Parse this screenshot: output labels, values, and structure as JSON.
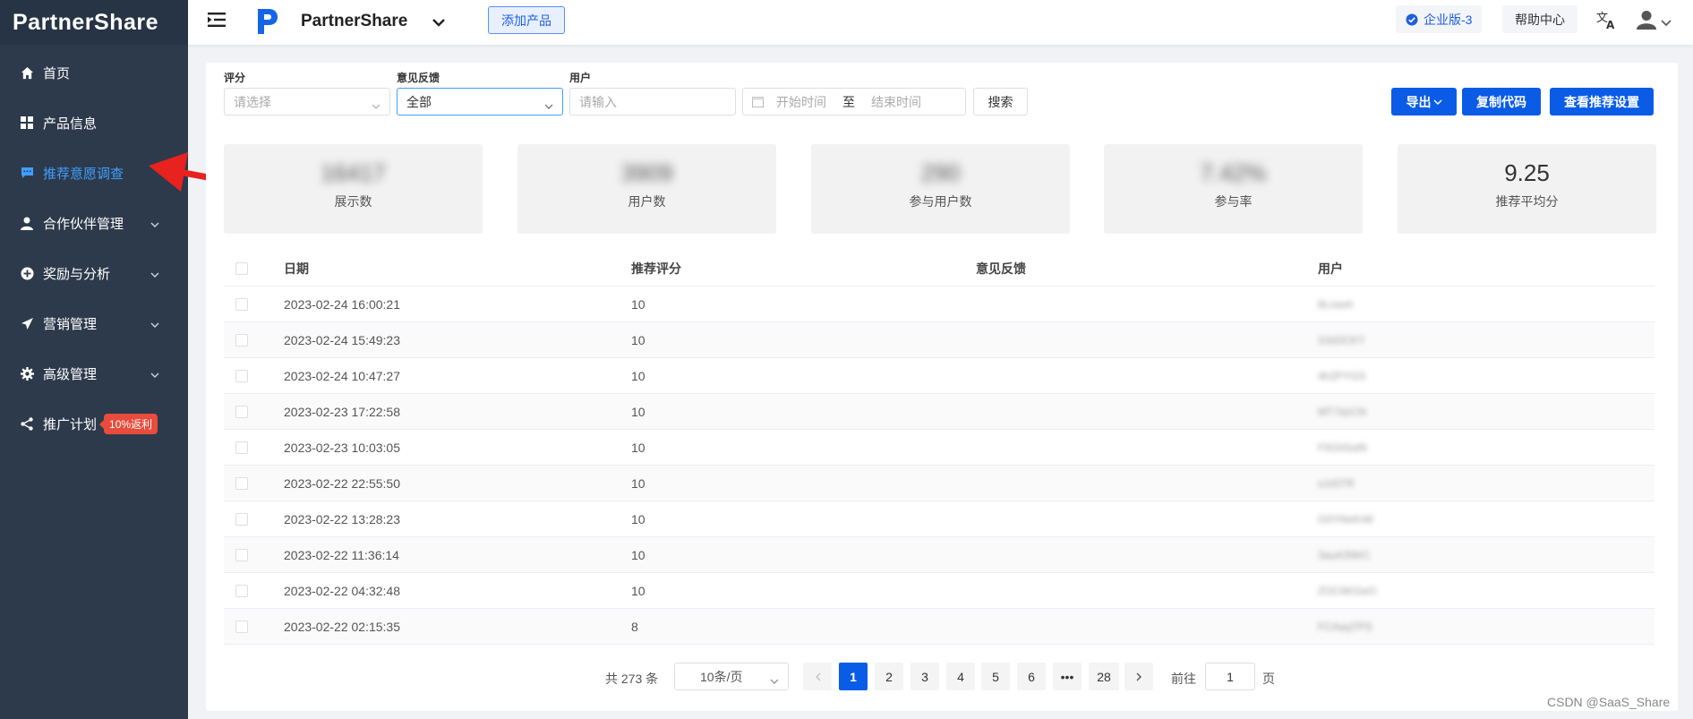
{
  "sidebar": {
    "logo": "PartnerShare",
    "items": [
      {
        "label": "首页",
        "icon": "home-icon"
      },
      {
        "label": "产品信息",
        "icon": "grid-icon"
      },
      {
        "label": "推荐意愿调查",
        "icon": "message-icon",
        "active": true
      },
      {
        "label": "合作伙伴管理",
        "icon": "user-icon"
      },
      {
        "label": "奖励与分析",
        "icon": "plus-circle-icon"
      },
      {
        "label": "营销管理",
        "icon": "send-icon"
      },
      {
        "label": "高级管理",
        "icon": "gear-icon"
      },
      {
        "label": "推广计划",
        "icon": "share-icon",
        "badge": "10%返利"
      }
    ]
  },
  "header": {
    "brand": "PartnerShare",
    "add_product": "添加产品",
    "edition": "企业版-3",
    "help": "帮助中心"
  },
  "filters": {
    "score_label": "评分",
    "score_placeholder": "请选择",
    "feedback_label": "意见反馈",
    "feedback_value": "全部",
    "user_label": "用户",
    "user_placeholder": "请输入",
    "start_placeholder": "开始时间",
    "date_sep": "至",
    "end_placeholder": "结束时间",
    "search": "搜索",
    "export": "导出",
    "copy_code": "复制代码",
    "view_settings": "查看推荐设置"
  },
  "stats": [
    {
      "value": "16417",
      "label": "展示数"
    },
    {
      "value": "3909",
      "label": "用户数"
    },
    {
      "value": "290",
      "label": "参与用户数"
    },
    {
      "value": "7.42%",
      "label": "参与率"
    },
    {
      "value": "9.25",
      "label": "推荐平均分"
    }
  ],
  "table": {
    "headers": {
      "date": "日期",
      "score": "推荐评分",
      "feedback": "意见反馈",
      "user": "用户"
    },
    "rows": [
      {
        "date": "2023-02-24 16:00:21",
        "score": "10",
        "feedback": "",
        "user": "8Lnaxh"
      },
      {
        "date": "2023-02-24 15:49:23",
        "score": "10",
        "feedback": "",
        "user": "3JeDCKY"
      },
      {
        "date": "2023-02-24 10:47:27",
        "score": "10",
        "feedback": "",
        "user": "4h2PYGS"
      },
      {
        "date": "2023-02-23 17:22:58",
        "score": "10",
        "feedback": "",
        "user": "MT7dzCN"
      },
      {
        "date": "2023-02-23 10:03:05",
        "score": "10",
        "feedback": "",
        "user": "F5Gh5stN"
      },
      {
        "date": "2023-02-22 22:55:50",
        "score": "10",
        "feedback": "",
        "user": "sJx5TR"
      },
      {
        "date": "2023-02-22 13:28:23",
        "score": "10",
        "feedback": "",
        "user": "G0YNeKrM"
      },
      {
        "date": "2023-02-22 11:36:14",
        "score": "10",
        "feedback": "",
        "user": "3auA3WrC"
      },
      {
        "date": "2023-02-22 04:32:48",
        "score": "10",
        "feedback": "",
        "user": "ZOC6KGeO"
      },
      {
        "date": "2023-02-22 02:15:35",
        "score": "8",
        "feedback": "",
        "user": "FCAaqTPS"
      }
    ]
  },
  "pagination": {
    "total": "共 273 条",
    "page_size": "10条/页",
    "pages": [
      "1",
      "2",
      "3",
      "4",
      "5",
      "6",
      "•••",
      "28"
    ],
    "goto_label": "前往",
    "goto_value": "1",
    "page_suffix": "页"
  },
  "watermark": "CSDN @SaaS_Share",
  "colors": {
    "sidebar": "#2d3a4b",
    "accent": "#0a5ce6",
    "active_menu": "#409eff",
    "badge": "#e94b3c"
  }
}
